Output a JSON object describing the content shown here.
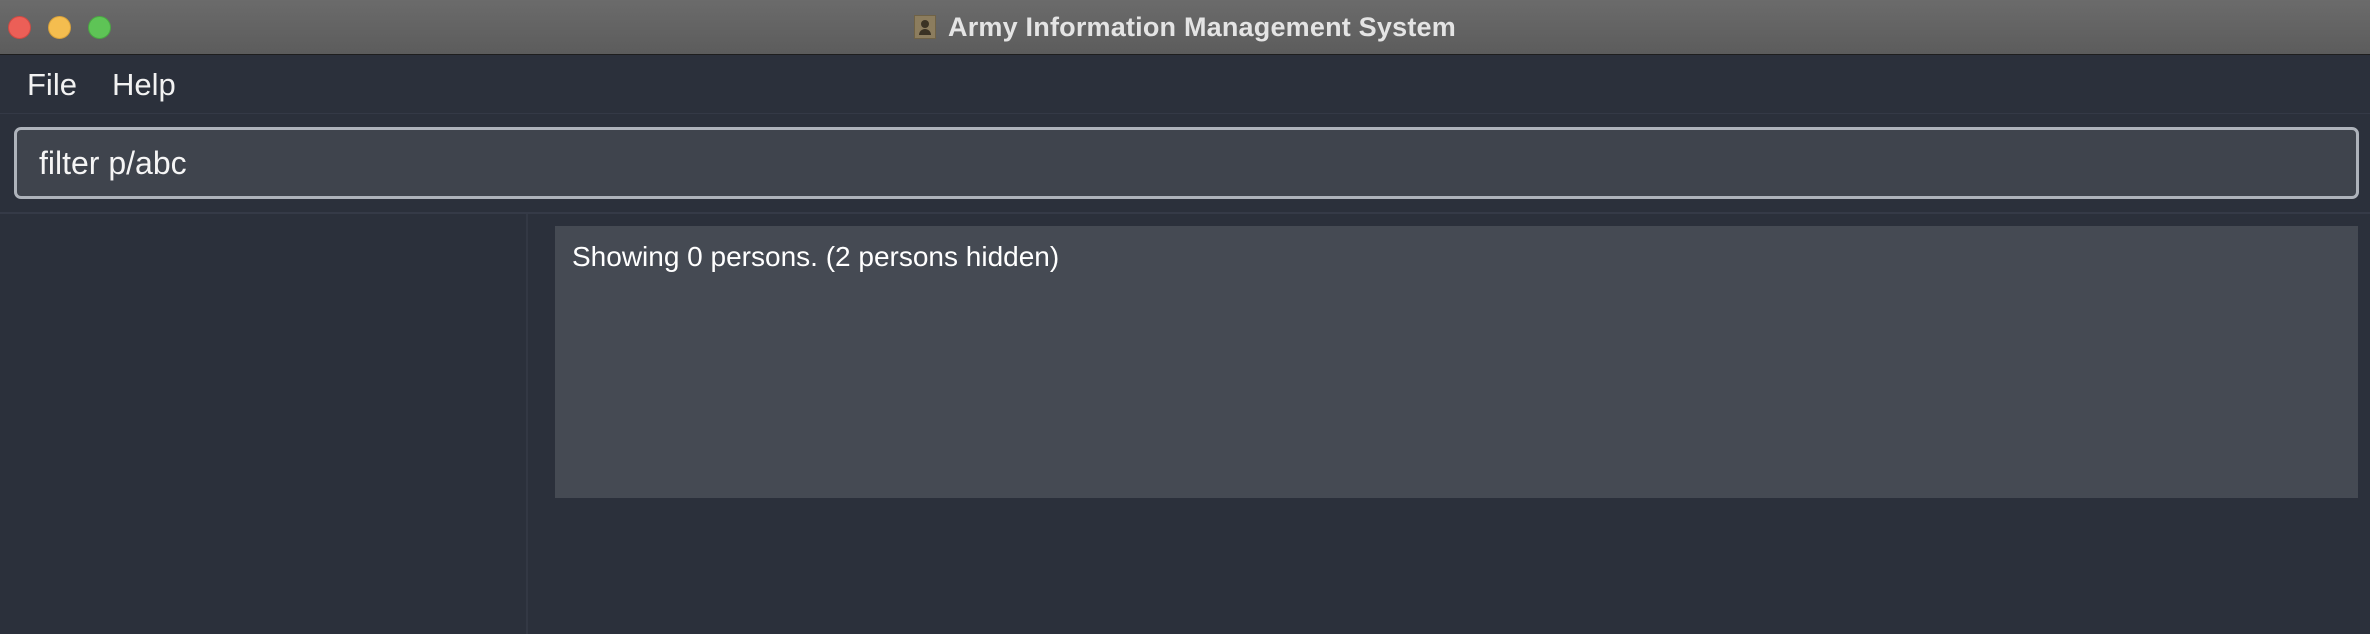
{
  "window": {
    "title": "Army Information Management System",
    "app_icon": "person-icon"
  },
  "menu": {
    "items": [
      {
        "label": "File"
      },
      {
        "label": "Help"
      }
    ]
  },
  "command": {
    "value": "filter p/abc",
    "placeholder": ""
  },
  "result": {
    "message": "Showing 0 persons. (2 persons hidden)"
  },
  "person_list": {
    "items": []
  },
  "colors": {
    "background": "#2b303b",
    "result_panel": "#454a53",
    "command_box": "#3f444d",
    "command_border": "#aeb3bb",
    "close": "#ec5f57",
    "minimize": "#f4bd4f",
    "maximize": "#5ec456"
  }
}
